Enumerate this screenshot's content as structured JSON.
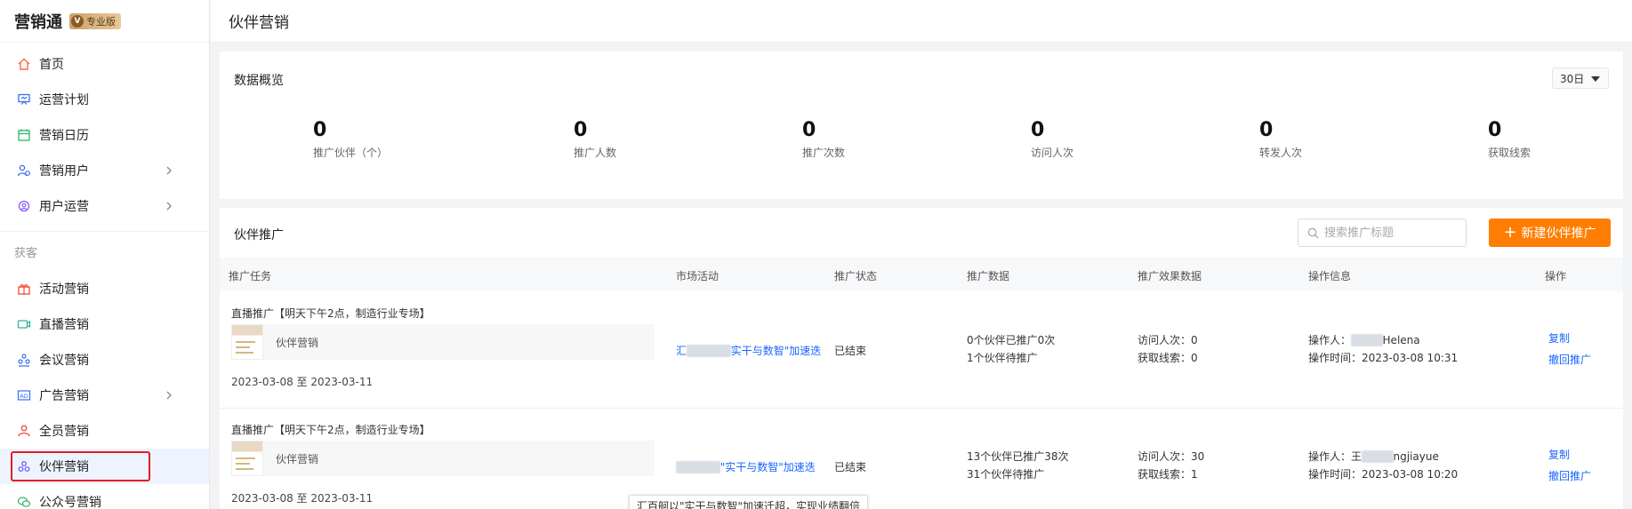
{
  "brand": {
    "name": "营销通",
    "badge": "专业版",
    "badge_icon_letter": "V"
  },
  "page_title": "伙伴营销",
  "sidebar": {
    "items_top": [
      {
        "label": "首页",
        "icon": "home-icon",
        "has_arrow": false
      },
      {
        "label": "运营计划",
        "icon": "presentation-icon",
        "has_arrow": false
      },
      {
        "label": "营销日历",
        "icon": "calendar-icon",
        "has_arrow": false
      },
      {
        "label": "营销用户",
        "icon": "users-icon",
        "has_arrow": true
      },
      {
        "label": "用户运营",
        "icon": "user-gear-icon",
        "has_arrow": true
      }
    ],
    "group_label": "获客",
    "items_bottom": [
      {
        "label": "活动营销",
        "icon": "gift-icon",
        "has_arrow": false
      },
      {
        "label": "直播营销",
        "icon": "video-icon",
        "has_arrow": false
      },
      {
        "label": "会议营销",
        "icon": "meeting-icon",
        "has_arrow": false
      },
      {
        "label": "广告营销",
        "icon": "ad-icon",
        "has_arrow": true
      },
      {
        "label": "全员营销",
        "icon": "staff-icon",
        "has_arrow": false
      },
      {
        "label": "伙伴营销",
        "icon": "partner-icon",
        "has_arrow": false,
        "active": true
      },
      {
        "label": "公众号营销",
        "icon": "wechat-icon",
        "has_arrow": false
      }
    ]
  },
  "overview": {
    "title": "数据概览",
    "period": "30日",
    "stats": [
      {
        "value": "0",
        "label": "推广伙伴（个）"
      },
      {
        "value": "0",
        "label": "推广人数"
      },
      {
        "value": "0",
        "label": "推广次数"
      },
      {
        "value": "0",
        "label": "访问人次"
      },
      {
        "value": "0",
        "label": "转发人次"
      },
      {
        "value": "0",
        "label": "获取线索"
      }
    ]
  },
  "promo": {
    "title": "伙伴推广",
    "search_placeholder": "搜索推广标题",
    "new_button": "新建伙伴推广",
    "columns": [
      "推广任务",
      "市场活动",
      "推广状态",
      "推广数据",
      "推广效果数据",
      "操作信息",
      "操作"
    ],
    "rows": [
      {
        "title": "直播推广【明天下午2点，制造行业专场】",
        "card_label": "伙伴营销",
        "date": "2023-03-08 至 2023-03-11",
        "activity_prefix": "汇",
        "activity_suffix": "实干与数智\"加速迭",
        "status": "已结束",
        "data_line1": "0个伙伴已推广0次",
        "data_line2": "1个伙伴待推广",
        "eff_line1": "访问人次：0",
        "eff_line2": "获取线索：0",
        "op_prefix": "操作人：",
        "op_suffix": "Helena",
        "op_time": "操作时间：2023-03-08 10:31",
        "action1": "复制",
        "action2": "撤回推广"
      },
      {
        "title": "直播推广【明天下午2点，制造行业专场】",
        "card_label": "伙伴营销",
        "date": "2023-03-08 至 2023-03-11",
        "activity_prefix": "",
        "activity_suffix": "\"实干与数智\"加速迭",
        "status": "已结束",
        "data_line1": "13个伙伴已推广38次",
        "data_line2": "31个伙伴待推广",
        "eff_line1": "访问人次：30",
        "eff_line2": "获取线索：1",
        "op_prefix": "操作人：王",
        "op_suffix": "ngjiayue",
        "op_time": "操作时间：2023-03-08 10:20",
        "action1": "复制",
        "action2": "撤回推广"
      }
    ],
    "tooltip": "汇百舸以\"实干与数智\"加速迁超，实现业绩翻倍"
  }
}
